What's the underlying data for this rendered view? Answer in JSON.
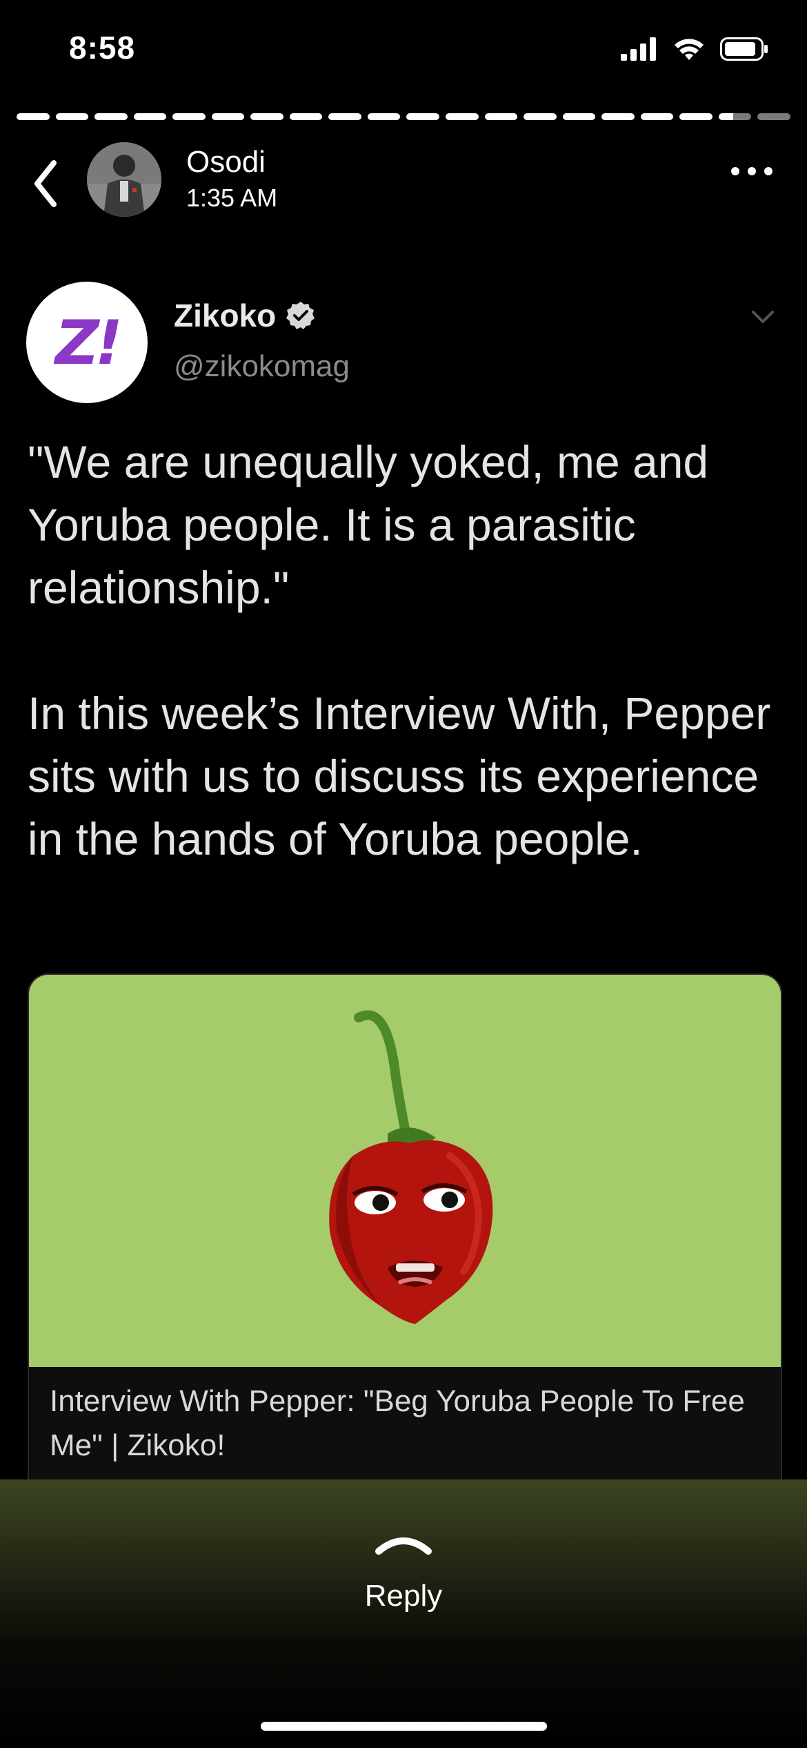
{
  "status_bar": {
    "time": "8:58",
    "icons": [
      "cellular-signal-icon",
      "wifi-icon",
      "battery-icon"
    ]
  },
  "story_progress": {
    "segments_viewed": 18,
    "segment_total": 20,
    "current_segment_fraction": 0.45
  },
  "story_header": {
    "back_icon": "chevron-left-icon",
    "user_name": "Osodi",
    "posted_time": "1:35 AM",
    "more_icon": "more-dots-icon"
  },
  "tweet": {
    "author_name": "Zikoko",
    "verified_icon": "verified-badge-icon",
    "handle": "@zikokomag",
    "logo_text": "Z!",
    "paragraphs": [
      "\"We are unequally yoked, me and Yoruba people. It is a parasitic relationship.\"",
      "In this week’s Interview With, Pepper sits with us to discuss its experience in the hands of Yoruba people."
    ],
    "card": {
      "image_subject": "pepper-character-image",
      "image_bg": "#a5cb6a",
      "title": "Interview With Pepper: \"Beg Yoruba People To Free Me\" | Zikoko!"
    }
  },
  "reply": {
    "label": "Reply",
    "icon": "chevron-up-icon"
  },
  "colors": {
    "background": "#000000",
    "brand_purple": "#8c38c6",
    "card_green": "#a5cb6a",
    "muted_text": "#8b8b8b"
  }
}
